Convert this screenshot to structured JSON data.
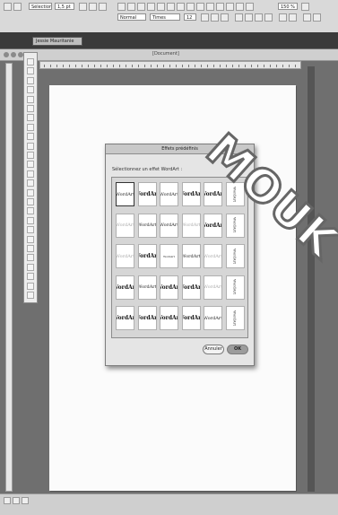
{
  "toolbar": {
    "zoom": "150 %",
    "style": "Normal",
    "font": "Times",
    "size": "12",
    "top_left_field": "Sélectionner",
    "top_left_field2": "1,5 pt"
  },
  "window": {
    "tab_label": "Jessie Mauritanie",
    "doc_title": "[Document]"
  },
  "dialog": {
    "title": "Effets prédéfinis",
    "prompt": "Sélectionnez un effet WordArt :",
    "cancel_label": "Annuler",
    "ok_label": "OK",
    "styles": [
      [
        "WordArt",
        "WordArt",
        "WordArt",
        "WordArt",
        "WordArt",
        "WordArt"
      ],
      [
        "WordArt",
        "WordArt",
        "WordArt",
        "WordArt",
        "WordArt",
        "WordArt"
      ],
      [
        "WordArt",
        "WordArt",
        "WordArt",
        "WordArt",
        "WordArt",
        "WordArt"
      ],
      [
        "WordArt",
        "WordArt",
        "WordArt",
        "WordArt",
        "WordArt",
        "WordArt"
      ],
      [
        "WordArt",
        "WordArt",
        "WordArt",
        "WordArt",
        "WordArt",
        "WordArt"
      ]
    ]
  },
  "overlay": {
    "wordart_text": "MOUK"
  }
}
